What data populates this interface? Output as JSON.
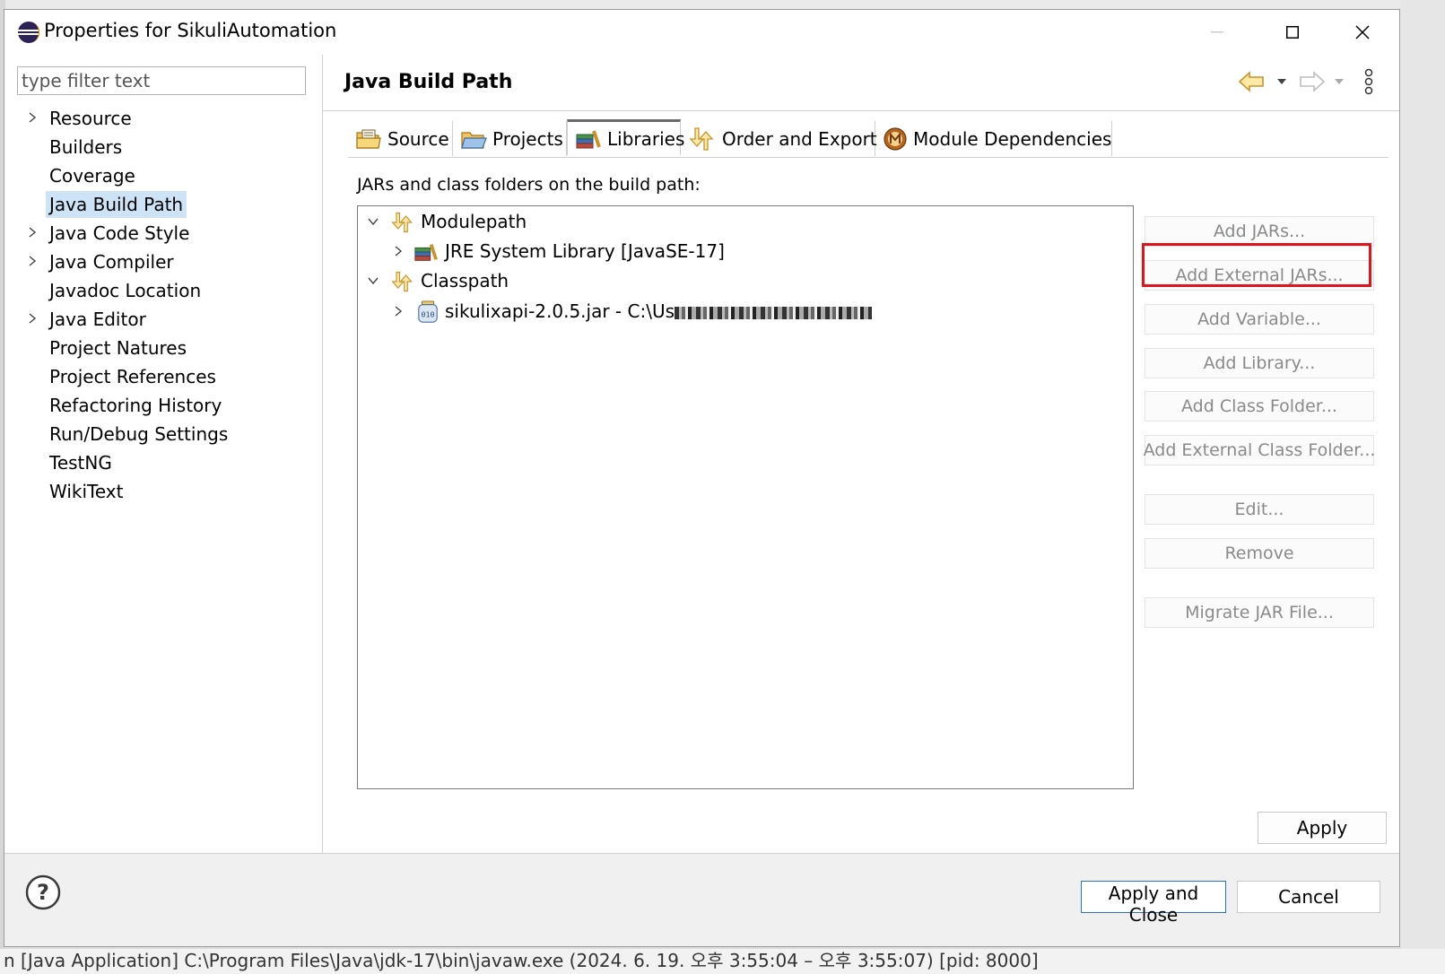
{
  "window": {
    "title": "Properties for SikuliAutomation"
  },
  "background_status": "n [Java Application] C:\\Program Files\\Java\\jdk-17\\bin\\javaw.exe (2024. 6. 19. 오후 3:55:04 – 오후 3:55:07) [pid: 8000]",
  "filter": {
    "placeholder": "type filter text"
  },
  "nav": {
    "items": [
      {
        "label": "Resource",
        "expandable": true
      },
      {
        "label": "Builders",
        "expandable": false
      },
      {
        "label": "Coverage",
        "expandable": false
      },
      {
        "label": "Java Build Path",
        "expandable": false,
        "selected": true
      },
      {
        "label": "Java Code Style",
        "expandable": true
      },
      {
        "label": "Java Compiler",
        "expandable": true
      },
      {
        "label": "Javadoc Location",
        "expandable": false
      },
      {
        "label": "Java Editor",
        "expandable": true
      },
      {
        "label": "Project Natures",
        "expandable": false
      },
      {
        "label": "Project References",
        "expandable": false
      },
      {
        "label": "Refactoring History",
        "expandable": false
      },
      {
        "label": "Run/Debug Settings",
        "expandable": false
      },
      {
        "label": "TestNG",
        "expandable": false
      },
      {
        "label": "WikiText",
        "expandable": false
      }
    ]
  },
  "page": {
    "title": "Java Build Path"
  },
  "tabs": [
    {
      "label": "Source",
      "icon": "source-folder-icon"
    },
    {
      "label": "Projects",
      "icon": "projects-folder-icon"
    },
    {
      "label": "Libraries",
      "icon": "libraries-icon",
      "active": true
    },
    {
      "label": "Order and Export",
      "icon": "order-export-icon"
    },
    {
      "label": "Module Dependencies",
      "icon": "module-icon"
    }
  ],
  "libraries": {
    "caption": "JARs and class folders on the build path:",
    "tree": {
      "modulepath": {
        "label": "Modulepath",
        "children": [
          {
            "label": "JRE System Library [JavaSE-17]"
          }
        ]
      },
      "classpath": {
        "label": "Classpath",
        "children": [
          {
            "label": "sikulixapi-2.0.5.jar - C:\\Us",
            "redacted": true
          }
        ]
      }
    }
  },
  "side_buttons": {
    "add_jars": "Add JARs...",
    "add_external_jars": "Add External JARs...",
    "add_variable": "Add Variable...",
    "add_library": "Add Library...",
    "add_class_folder": "Add Class Folder...",
    "add_external_class_folder": "Add External Class Folder...",
    "edit": "Edit...",
    "remove": "Remove",
    "migrate_jar": "Migrate JAR File..."
  },
  "buttons": {
    "apply": "Apply",
    "apply_and_close": "Apply and Close",
    "cancel": "Cancel"
  },
  "colors": {
    "selection": "#cde4f7",
    "highlight_box": "#e0141c",
    "default_button_border": "#2a73c8",
    "disabled_text": "#8a8a8a"
  }
}
